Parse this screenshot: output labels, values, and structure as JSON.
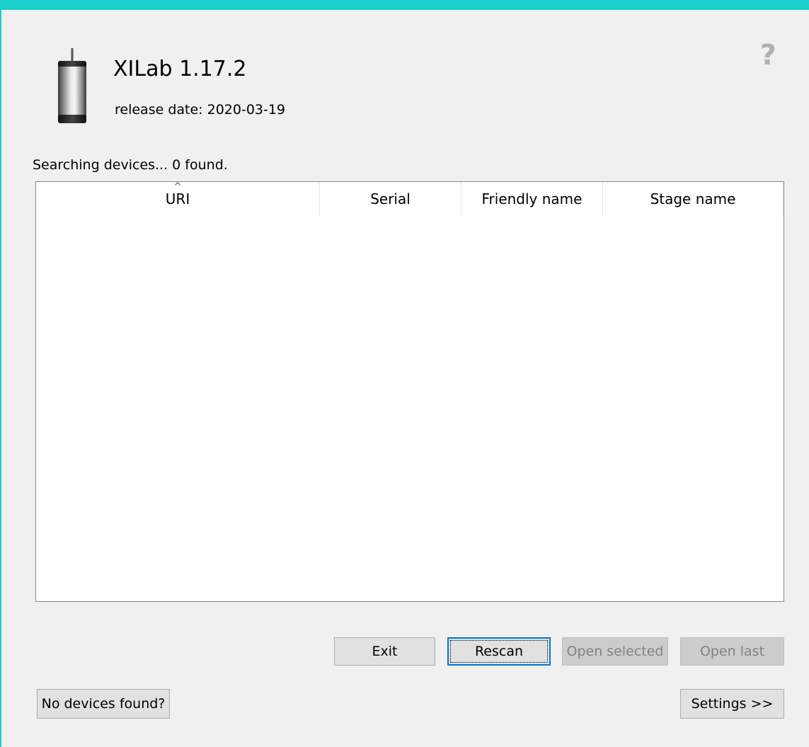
{
  "app": {
    "title": "XILab 1.17.2",
    "release_date": "release date: 2020-03-19",
    "help_symbol": "?"
  },
  "status": {
    "text": "Searching devices... 0 found."
  },
  "table": {
    "columns": [
      "URI",
      "Serial",
      "Friendly name",
      "Stage name"
    ],
    "sort_column": "URI",
    "sort_indicator": "^",
    "rows": []
  },
  "buttons": {
    "exit": "Exit",
    "rescan": "Rescan",
    "open_selected": "Open selected",
    "open_last": "Open last",
    "no_devices": "No devices found?",
    "settings": "Settings >>"
  },
  "colors": {
    "accent": "#1ccfcf",
    "window_bg": "#f0f0f0",
    "button_bg": "#e1e1e1",
    "focus_border": "#0078d7",
    "disabled_text": "#838383"
  },
  "icons": {
    "help": "question-mark-icon",
    "product": "motor-cylinder-icon"
  }
}
